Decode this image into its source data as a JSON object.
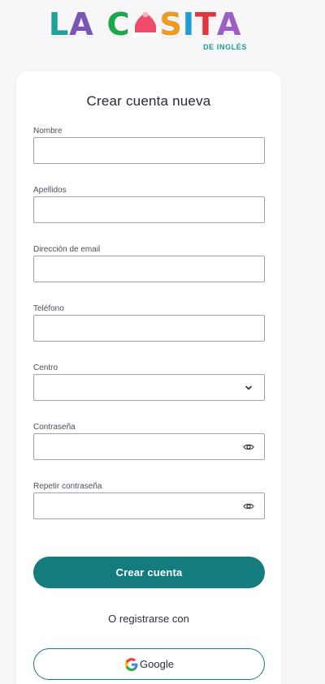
{
  "logo": {
    "letters": [
      {
        "char": "L",
        "color": "#1aa39a"
      },
      {
        "char": "A",
        "color": "#7b56b8"
      },
      {
        "char": "C",
        "color": "#19a84a"
      },
      {
        "char": "S",
        "color": "#f29a1e"
      },
      {
        "char": "I",
        "color": "#1c9bd6"
      },
      {
        "char": "T",
        "color": "#e2343a"
      },
      {
        "char": "A",
        "color": "#9d5fc7"
      }
    ],
    "house_icon": "house-icon",
    "house_color": "#ee4c6a",
    "subtitle": "DE INGLÉS"
  },
  "form": {
    "title": "Crear cuenta nueva",
    "fields": [
      {
        "label": "Nombre",
        "value": ""
      },
      {
        "label": "Apellidos",
        "value": ""
      },
      {
        "label": "Dirección de email",
        "value": ""
      },
      {
        "label": "Teléfono",
        "value": ""
      },
      {
        "label": "Centro",
        "value": "",
        "icon": "chevron-down-icon"
      },
      {
        "label": "Contraseña",
        "value": "",
        "icon": "eye-icon"
      },
      {
        "label": "Repetir contraseña",
        "value": "",
        "icon": "eye-icon"
      }
    ],
    "submit_label": "Crear cuenta",
    "alt_text": "O registrarse con",
    "google_label": "Google",
    "google_icon": "google-g-icon"
  },
  "colors": {
    "primary": "#147b7e",
    "border": "#9ea3b3",
    "background": "#f7f7f9"
  }
}
